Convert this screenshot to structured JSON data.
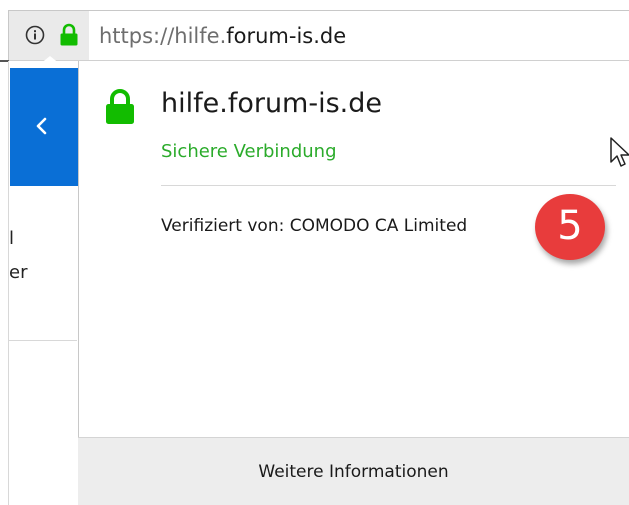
{
  "urlbar": {
    "url_scheme": "https://",
    "url_subdomain": "hilfe.",
    "url_host": "forum-is.de",
    "info_icon": "info-icon",
    "lock_icon": "lock-icon"
  },
  "page": {
    "back_icon": "chevron-left-icon",
    "left_text_1": "l",
    "left_text_2": "er"
  },
  "popup": {
    "host": "hilfe.forum-is.de",
    "connection_status": "Sichere Verbindung",
    "verified_by": "Verifiziert von: COMODO CA Limited",
    "more_info_label": "Weitere Informationen",
    "step_badge": "5"
  },
  "colors": {
    "secure_green": "#2bab2b",
    "lock_green": "#12bc00",
    "back_panel_blue": "#0a6fd6",
    "badge_red": "#e83c3c"
  }
}
